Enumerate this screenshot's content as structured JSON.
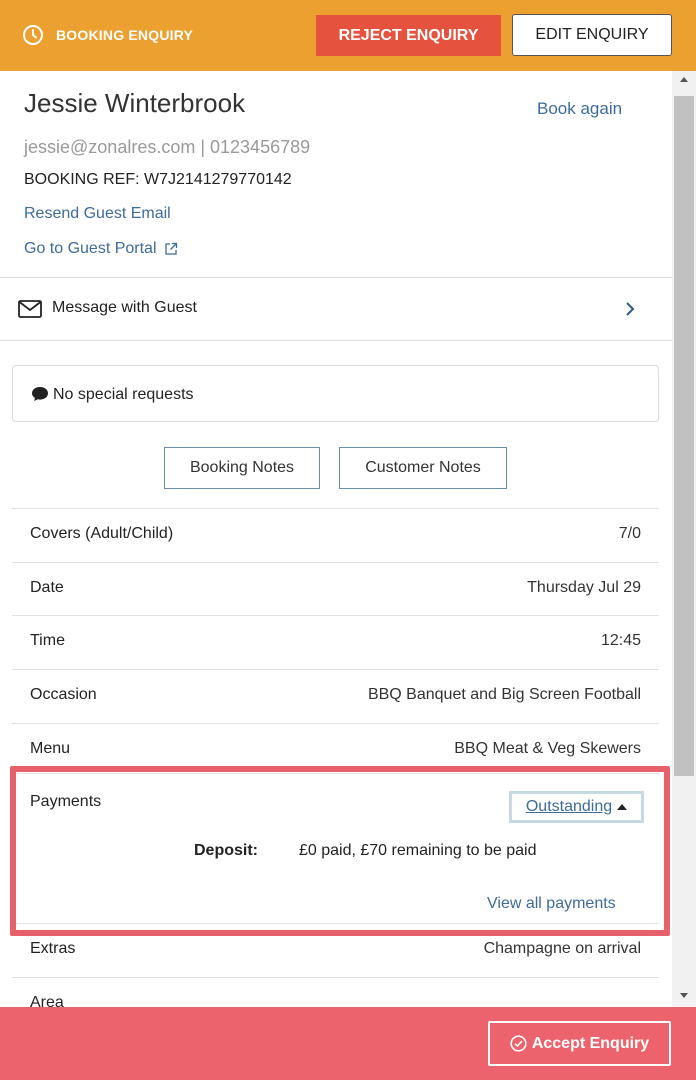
{
  "header": {
    "title": "BOOKING ENQUIRY",
    "reject_label": "REJECT ENQUIRY",
    "edit_label": "EDIT ENQUIRY",
    "bg_color": "#eba030",
    "reject_color": "#e5533f"
  },
  "guest": {
    "name": "Jessie Winterbrook",
    "book_again": "Book again",
    "contact": "jessie@zonalres.com | 0123456789",
    "booking_ref": "BOOKING REF: W7J2141279770142",
    "resend_email": "Resend Guest Email",
    "guest_portal": "Go to Guest Portal"
  },
  "message": {
    "label": "Message with Guest",
    "icon": "envelope-icon"
  },
  "special_requests": {
    "label": "No special requests",
    "icon": "speech-bubble-icon"
  },
  "notes": {
    "booking_notes": "Booking Notes",
    "customer_notes": "Customer Notes"
  },
  "details": [
    {
      "label": "Covers (Adult/Child)",
      "value": "7/0"
    },
    {
      "label": "Date",
      "value": "Thursday Jul 29"
    },
    {
      "label": "Time",
      "value": "12:45"
    },
    {
      "label": "Occasion",
      "value": "BBQ Banquet and Big Screen Football"
    },
    {
      "label": "Menu",
      "value": "BBQ Meat & Veg Skewers"
    }
  ],
  "payments": {
    "label": "Payments",
    "status": "Outstanding",
    "deposit_label": "Deposit:",
    "deposit_value": "£0 paid, £70 remaining to be paid",
    "view_all": "View all payments"
  },
  "extras": {
    "label": "Extras",
    "value": "Champagne on arrival"
  },
  "area": {
    "label": "Area"
  },
  "footer": {
    "accept_label": "Accept Enquiry",
    "bg_color": "#ec636d"
  }
}
